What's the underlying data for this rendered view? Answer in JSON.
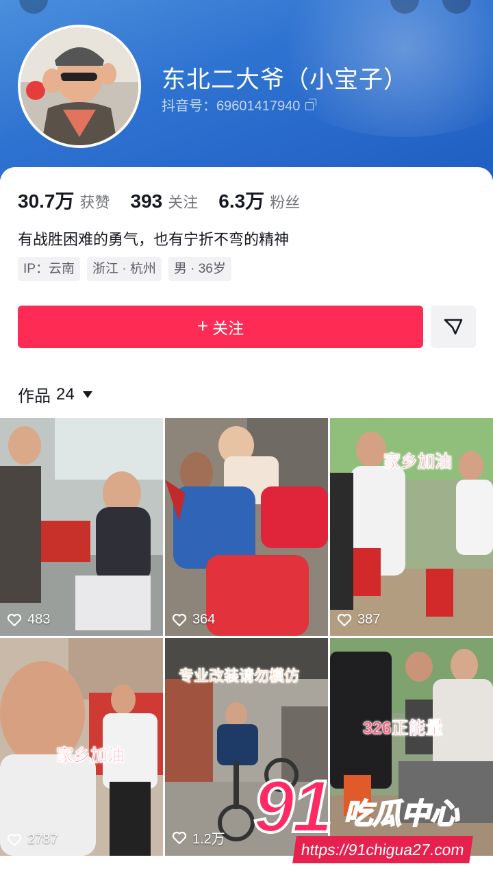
{
  "profile": {
    "nickname": "东北二大爷（小宝子）",
    "douyin_id": "抖音号：69601417940",
    "bio": "有战胜困难的勇气，也有宁折不弯的精神",
    "tags": [
      "IP：云南",
      "浙江 · 杭州",
      "男 · 36岁"
    ]
  },
  "stats": {
    "likes_value": "30.7万",
    "likes_label": "获赞",
    "following_value": "393",
    "following_label": "关注",
    "fans_value": "6.3万",
    "fans_label": "粉丝"
  },
  "actions": {
    "follow_label": "关注",
    "share_icon": "send-icon"
  },
  "works": {
    "label": "作品",
    "count": "24"
  },
  "videos": [
    {
      "likes": "483",
      "overlay": ""
    },
    {
      "likes": "364",
      "overlay": ""
    },
    {
      "likes": "387",
      "overlay": "家乡加油"
    },
    {
      "likes": "2787",
      "overlay": "家乡加油"
    },
    {
      "likes": "1.2万",
      "overlay": "专业改装请勿模仿"
    },
    {
      "likes": "",
      "overlay": "326正能量"
    }
  ],
  "watermark": {
    "number": "91",
    "name": "吃瓜中心",
    "url": "https://91chigua27.com"
  },
  "colors": {
    "accent": "#fe2c55",
    "header": "#2f73d1"
  }
}
